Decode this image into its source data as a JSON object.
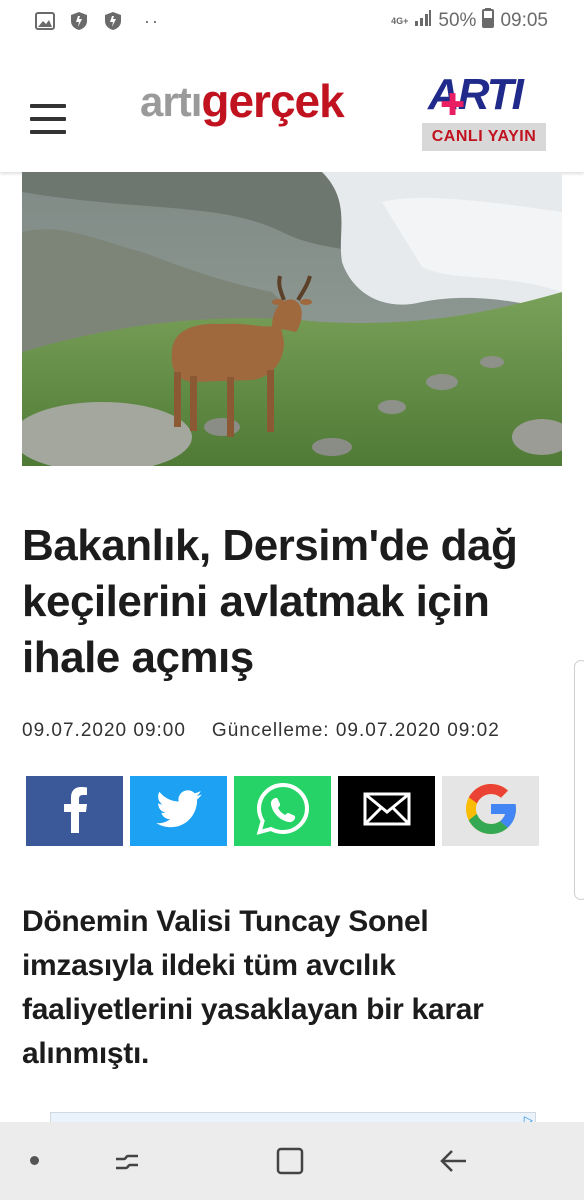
{
  "status_bar": {
    "network": "4G+",
    "battery_percent": "50%",
    "time": "09:05",
    "left_icons": [
      "gallery-icon",
      "shield-icon",
      "shield-icon",
      "more-dots-icon"
    ]
  },
  "header": {
    "logo_part1": "artı",
    "logo_part2": "gerçek",
    "live_logo": "ARTI",
    "live_label": "CANLI YAYIN",
    "colors": {
      "logo_red": "#c1121f",
      "logo_gray": "#9a9a9a",
      "live_blue": "#1f2a8a"
    }
  },
  "article": {
    "title": "Bakanlık, Dersim'de dağ keçilerini avlatmak için ihale açmış",
    "published": "09.07.2020 09:00",
    "updated": "Güncelleme: 09.07.2020 09:02",
    "lead": "Dönemin Valisi Tuncay Sonel imzasıyla ildeki tüm avcılık faaliyetlerini yasaklayan bir karar alınmıştı."
  },
  "share_buttons": [
    {
      "name": "facebook",
      "icon": "facebook-icon",
      "color": "#3b5998"
    },
    {
      "name": "twitter",
      "icon": "twitter-icon",
      "color": "#1da1f2"
    },
    {
      "name": "whatsapp",
      "icon": "whatsapp-icon",
      "color": "#25d366"
    },
    {
      "name": "email",
      "icon": "mail-icon",
      "color": "#000000"
    },
    {
      "name": "google",
      "icon": "google-icon",
      "color": "#e5e5e5"
    }
  ],
  "nav_bar": [
    "recent-apps-icon",
    "home-icon",
    "back-icon"
  ]
}
